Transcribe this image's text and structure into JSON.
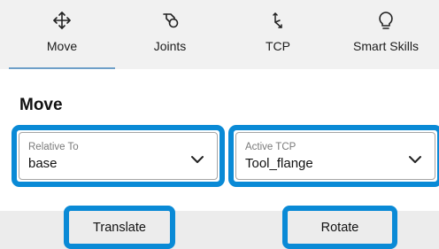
{
  "tabs": [
    {
      "label": "Move",
      "icon": "move-arrows-icon",
      "active": true
    },
    {
      "label": "Joints",
      "icon": "joints-icon",
      "active": false
    },
    {
      "label": "TCP",
      "icon": "tcp-axes-icon",
      "active": false
    },
    {
      "label": "Smart Skills",
      "icon": "lightbulb-icon",
      "active": false
    }
  ],
  "section": {
    "title": "Move"
  },
  "relative_to": {
    "caption": "Relative To",
    "value": "base"
  },
  "active_tcp": {
    "caption": "Active TCP",
    "value": "Tool_flange"
  },
  "buttons": {
    "translate": "Translate",
    "rotate": "Rotate"
  },
  "colors": {
    "highlight": "#0a8ad6",
    "tab_underline": "#6e9fc8",
    "tabbar_bg": "#f1f1f1"
  }
}
